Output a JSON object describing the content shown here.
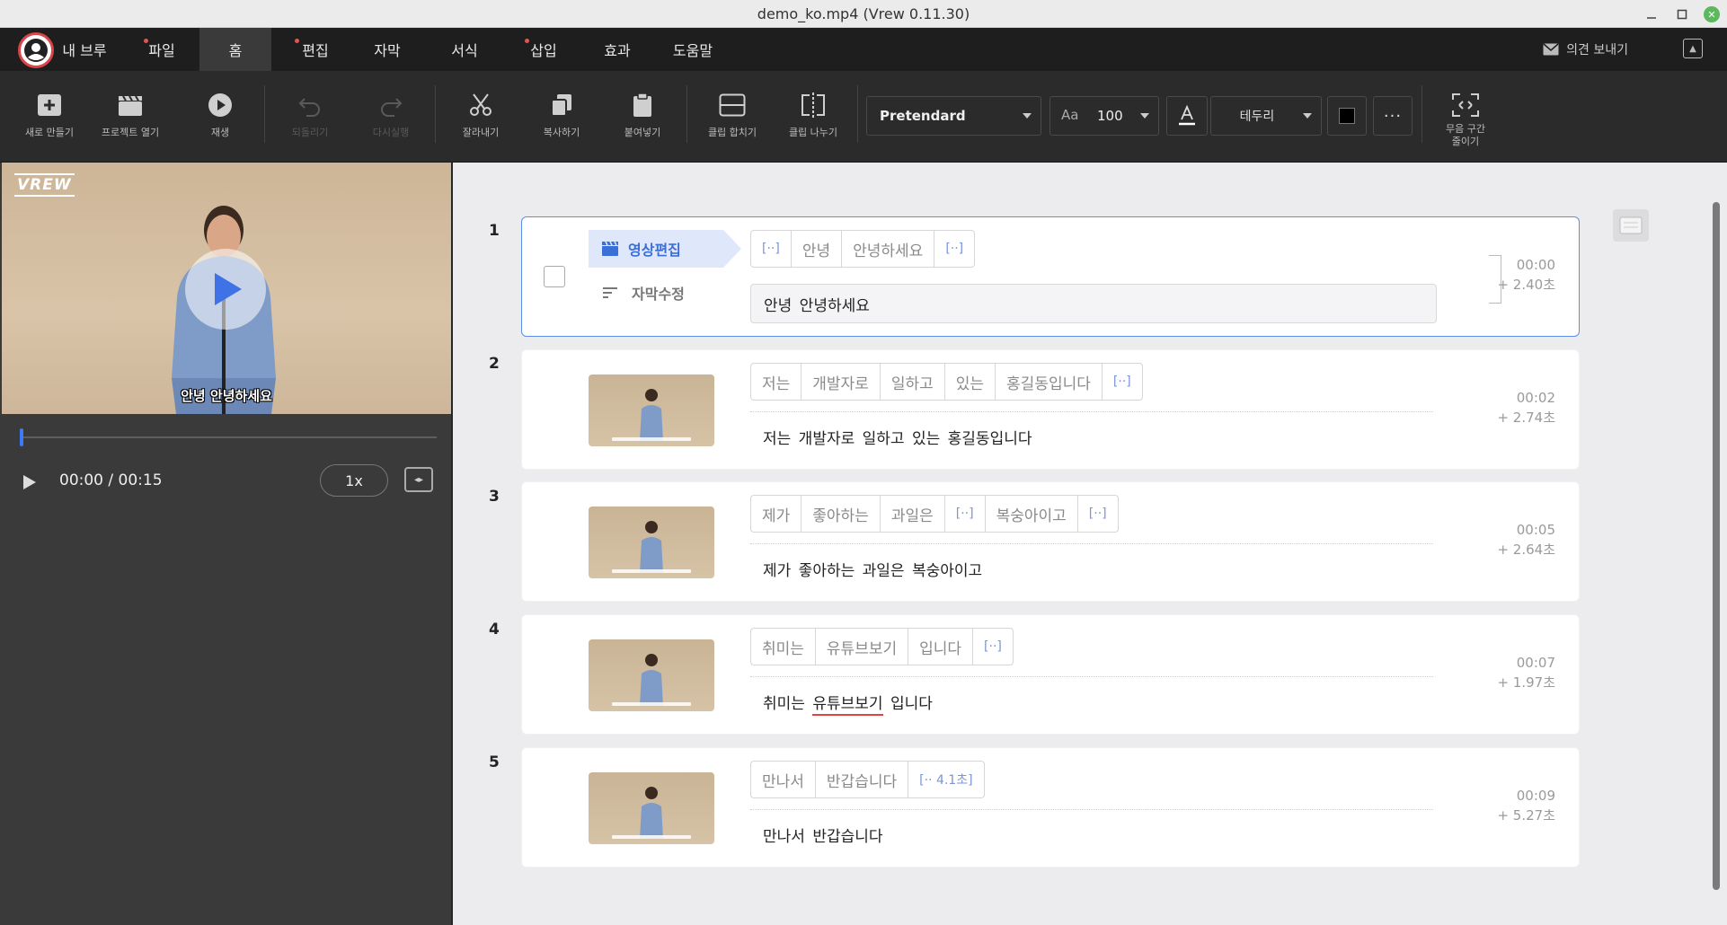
{
  "window": {
    "title": "demo_ko.mp4 (Vrew 0.11.30)"
  },
  "menu": {
    "user": "내 브루",
    "items": [
      {
        "label": "파일",
        "dot": true
      },
      {
        "label": "홈",
        "dot": false,
        "active": true
      },
      {
        "label": "편집",
        "dot": true
      },
      {
        "label": "자막",
        "dot": false
      },
      {
        "label": "서식",
        "dot": false
      },
      {
        "label": "삽입",
        "dot": true
      },
      {
        "label": "효과",
        "dot": false
      },
      {
        "label": "도움말",
        "dot": false
      }
    ],
    "feedback": "의견 보내기"
  },
  "toolbar": {
    "new": "새로 만들기",
    "open": "프로젝트 열기",
    "play": "재생",
    "undo": "되돌리기",
    "redo": "다시실행",
    "cut": "잘라내기",
    "copy": "복사하기",
    "paste": "붙여넣기",
    "merge": "클립 합치기",
    "split": "클립 나누기",
    "font": "Pretendard",
    "font_size": "100",
    "border": "테두리",
    "silence_line1": "무음 구간",
    "silence_line2": "줄이기"
  },
  "player": {
    "logo": "VREW",
    "caption": "안녕 안녕하세요",
    "time": "00:00 / 00:15",
    "speed": "1x",
    "progress": 0.0
  },
  "clips": [
    {
      "num": "1",
      "selected": true,
      "tag_video": "영상편집",
      "tag_sub": "자막수정",
      "words": [
        "[··]",
        "안녕",
        "안녕하세요",
        "[··]"
      ],
      "subtitle": "안녕 안녕하세요",
      "start": "00:00",
      "duration": "+ 2.40초"
    },
    {
      "num": "2",
      "words": [
        "저는",
        "개발자로",
        "일하고",
        "있는",
        "홍길동입니다",
        "[··]"
      ],
      "subtitle": "저는 개발자로 일하고 있는 홍길동입니다",
      "start": "00:02",
      "duration": "+ 2.74초"
    },
    {
      "num": "3",
      "words": [
        "제가",
        "좋아하는",
        "과일은",
        "[··]",
        "복숭아이고",
        "[··]"
      ],
      "subtitle": "제가 좋아하는 과일은 복숭아이고",
      "start": "00:05",
      "duration": "+ 2.64초"
    },
    {
      "num": "4",
      "words": [
        "취미는",
        "유튜브보기",
        "입니다",
        "[··]"
      ],
      "subtitle_pre": "취미는",
      "subtitle_err": "유튜브보기",
      "subtitle_post": "입니다",
      "start": "00:07",
      "duration": "+ 1.97초"
    },
    {
      "num": "5",
      "words": [
        "만나서",
        "반갑습니다",
        "[·· 4.1초]"
      ],
      "subtitle": "만나서 반갑습니다",
      "start": "00:09",
      "duration": "+ 5.27초"
    }
  ]
}
